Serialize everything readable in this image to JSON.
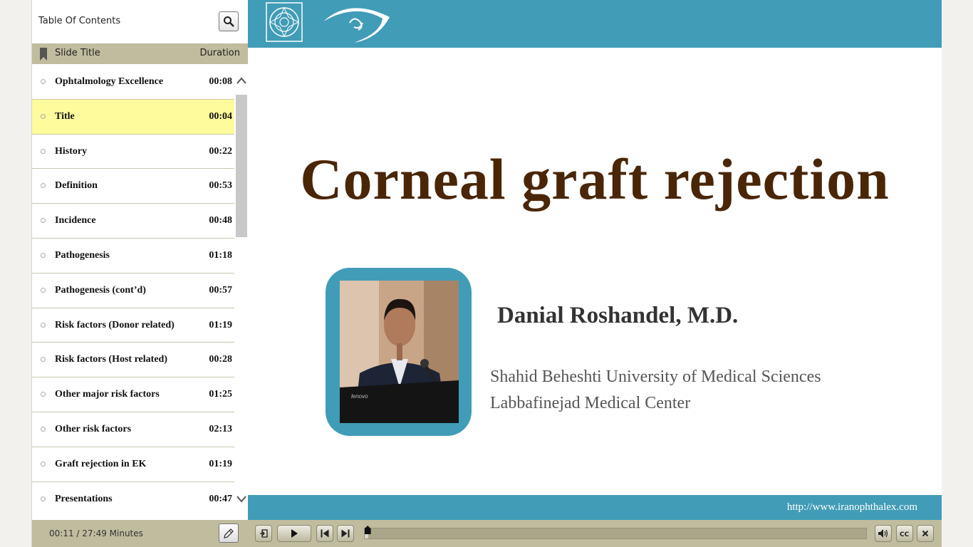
{
  "sidebar": {
    "title": "Table Of Contents",
    "columns": {
      "title": "Slide Title",
      "duration": "Duration"
    },
    "items": [
      {
        "title": "Ophtalmology Excellence",
        "duration": "00:08",
        "active": false
      },
      {
        "title": "Title",
        "duration": "00:04",
        "active": true
      },
      {
        "title": "History",
        "duration": "00:22",
        "active": false
      },
      {
        "title": "Definition",
        "duration": "00:53",
        "active": false
      },
      {
        "title": "Incidence",
        "duration": "00:48",
        "active": false
      },
      {
        "title": "Pathogenesis",
        "duration": "01:18",
        "active": false
      },
      {
        "title": "Pathogenesis (cont’d)",
        "duration": "00:57",
        "active": false
      },
      {
        "title": "Risk factors (Donor related)",
        "duration": "01:19",
        "active": false
      },
      {
        "title": "Risk factors (Host related)",
        "duration": "00:28",
        "active": false
      },
      {
        "title": "Other major risk factors",
        "duration": "01:25",
        "active": false
      },
      {
        "title": "Other risk factors",
        "duration": "02:13",
        "active": false
      },
      {
        "title": "Graft rejection in EK",
        "duration": "01:19",
        "active": false
      },
      {
        "title": "Presentations",
        "duration": "00:47",
        "active": false
      }
    ],
    "footer": {
      "time": "00:11 / 27:49 Minutes"
    }
  },
  "slide": {
    "heading": "Corneal graft rejection",
    "author": "Danial Roshandel, M.D.",
    "affiliation_1": "Shahid Beheshti University of Medical Sciences",
    "affiliation_2": "Labbafinejad Medical Center",
    "url": "http://www.iranophthalex.com",
    "laptop_brand": "lenovo",
    "colors": {
      "banner": "#419cb7",
      "heading": "#4a2607"
    }
  },
  "player": {
    "progress": 0.0066,
    "icons": [
      "exit-icon",
      "play-icon",
      "previous-icon",
      "next-icon",
      "volume-icon",
      "cc-icon",
      "close-icon"
    ],
    "cc_label": "CC"
  },
  "colors": {
    "panel": "#c0bc9e",
    "active_row": "#fdfb9b"
  }
}
